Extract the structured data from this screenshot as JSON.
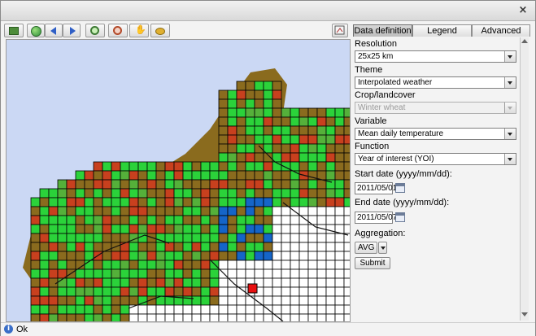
{
  "window": {
    "close_label": "×"
  },
  "tabs": [
    {
      "label": "Data definition",
      "active": true
    },
    {
      "label": "Legend",
      "active": false
    },
    {
      "label": "Advanced",
      "active": false
    }
  ],
  "form": {
    "resolution_label": "Resolution",
    "resolution_value": "25x25 km",
    "theme_label": "Theme",
    "theme_value": "Interpolated weather",
    "crop_label": "Crop/landcover",
    "crop_value": "Winter wheat",
    "variable_label": "Variable",
    "variable_value": "Mean daily temperature",
    "function_label": "Function",
    "function_value": "Year of interest (YOI)",
    "start_label": "Start date (yyyy/mm/dd):",
    "start_value": "2011/05/01",
    "end_label": "End date (yyyy/mm/dd):",
    "end_value": "2011/05/07",
    "aggregation_label": "Aggregation:",
    "aggregation_value": "AVG",
    "submit_label": "Submit"
  },
  "status": {
    "text": "Ok"
  },
  "colors": {
    "sea": "#cbd8f4",
    "land": "#8a6b1e",
    "grid_line": "#000000",
    "warm": "#c8401e",
    "mild": "#8a6b1e",
    "cool": "#2bd23a",
    "cold": "#1565c8",
    "nodata": "#ffffff",
    "accent_red": "#e81010"
  },
  "toolbar_icons": [
    "show-layer-icon",
    "globe-icon",
    "back-arrow-icon",
    "forward-arrow-icon",
    "zoom-in-icon",
    "zoom-out-icon",
    "pan-hand-icon",
    "identify-icon"
  ]
}
